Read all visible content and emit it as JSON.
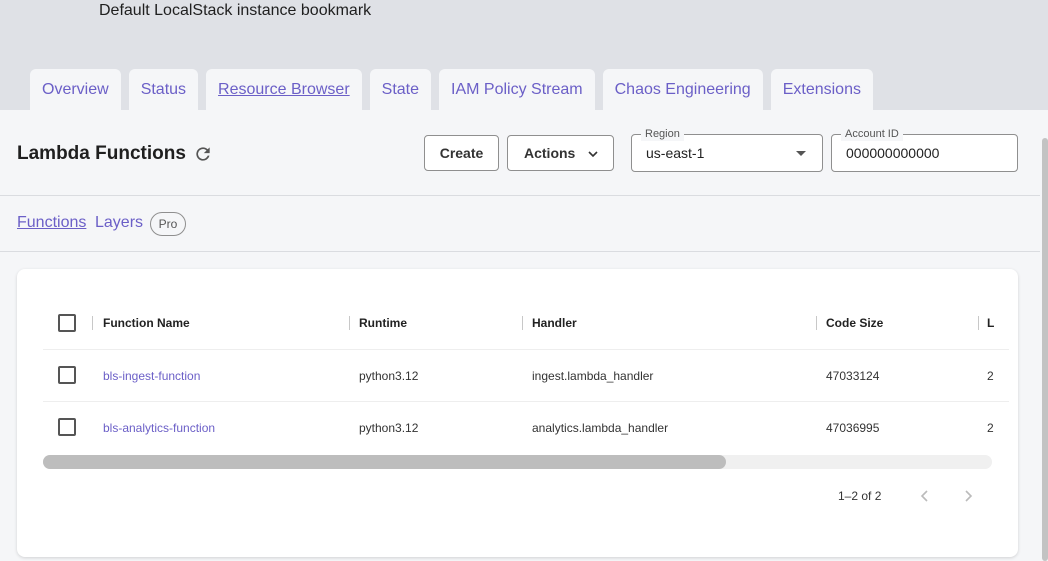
{
  "instance": {
    "title": "Default LocalStack instance bookmark"
  },
  "tabs": [
    {
      "label": "Overview"
    },
    {
      "label": "Status"
    },
    {
      "label": "Resource Browser",
      "active": true
    },
    {
      "label": "State"
    },
    {
      "label": "IAM Policy Stream"
    },
    {
      "label": "Chaos Engineering"
    },
    {
      "label": "Extensions"
    }
  ],
  "toolbar": {
    "title": "Lambda Functions",
    "create_label": "Create",
    "actions_label": "Actions",
    "region": {
      "label": "Region",
      "value": "us-east-1"
    },
    "account": {
      "label": "Account ID",
      "value": "000000000000"
    }
  },
  "subnav": {
    "functions": "Functions",
    "layers": "Layers",
    "pro_badge": "Pro"
  },
  "table": {
    "columns": [
      "Function Name",
      "Runtime",
      "Handler",
      "Code Size",
      "L"
    ],
    "rows": [
      {
        "name": "bls-ingest-function",
        "runtime": "python3.12",
        "handler": "ingest.lambda_handler",
        "code_size": "47033124",
        "last": "2"
      },
      {
        "name": "bls-analytics-function",
        "runtime": "python3.12",
        "handler": "analytics.lambda_handler",
        "code_size": "47036995",
        "last": "2"
      }
    ],
    "pagination": "1–2 of 2"
  },
  "colors": {
    "accent": "#6b5fc7",
    "top_band": "#dfe1e6",
    "background": "#f5f6f8"
  }
}
